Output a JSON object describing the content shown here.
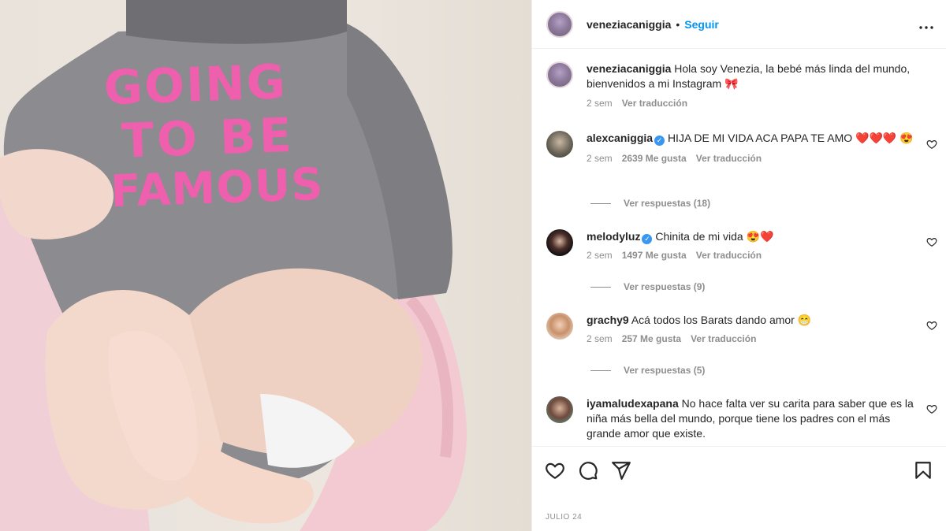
{
  "post": {
    "shirt_print": [
      "GOING",
      "TO BE",
      "FAMOUS"
    ],
    "author": "veneziacaniggia",
    "separator": "•",
    "follow_label": "Seguir",
    "more_label": "•••",
    "date": "JULIO 24"
  },
  "caption": {
    "username": "veneziacaniggia",
    "text": "Hola soy Venezia, la bebé más linda del mundo, bienvenidos a mi Instagram 🎀",
    "age": "2 sem",
    "translate": "Ver traducción"
  },
  "comments": [
    {
      "username": "alexcaniggia",
      "verified": true,
      "text": "HIJA DE MI VIDA ACA PAPA TE AMO ❤️❤️❤️ 😍",
      "age": "2 sem",
      "likes": "2639 Me gusta",
      "translate": "Ver traducción",
      "replies": "Ver respuestas (18)"
    },
    {
      "username": "melodyluz",
      "verified": true,
      "text": "Chinita de mi vida 😍❤️",
      "age": "2 sem",
      "likes": "1497 Me gusta",
      "translate": "Ver traducción",
      "replies": "Ver respuestas (9)"
    },
    {
      "username": "grachy9",
      "verified": false,
      "text": "Acá todos los Barats dando amor 😁",
      "age": "2 sem",
      "likes": "257 Me gusta",
      "translate": "Ver traducción",
      "replies": "Ver respuestas (5)"
    },
    {
      "username": "iyamaludexapana",
      "verified": false,
      "text": "No hace falta ver su carita para saber que es la niña más bella del mundo, porque tiene los padres con el más grande amor que existe."
    }
  ],
  "colors": {
    "accent": "#0095f6",
    "shirt_print": "#ee5fae",
    "muted": "#8e8e8e",
    "verified": "#3897f0"
  },
  "icons": [
    "heart-icon",
    "comment-icon",
    "share-icon",
    "bookmark-icon",
    "more-icon",
    "verified-badge-icon"
  ]
}
